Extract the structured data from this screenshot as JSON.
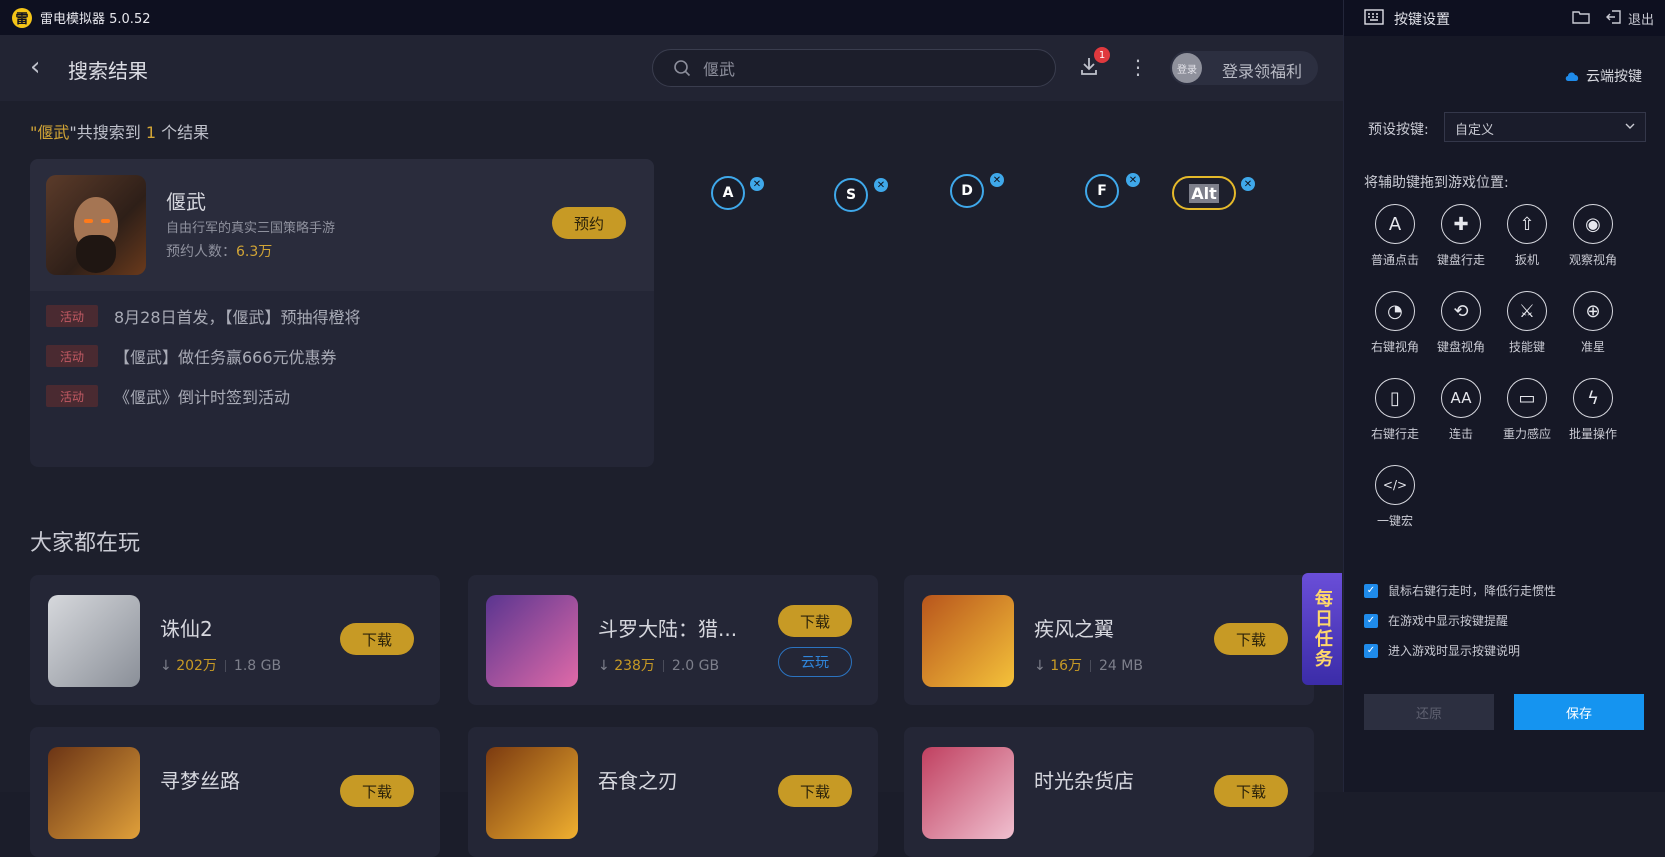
{
  "app": {
    "logo_letter": "雷",
    "title": "雷电模拟器 5.0.52"
  },
  "header": {
    "page_title": "搜索结果",
    "search_value": "偃武",
    "download_badge": "1",
    "avatar_text": "登录",
    "login_label": "登录领福利"
  },
  "result": {
    "prefix": "\"",
    "keyword": "偃武",
    "mid": "\"共搜索到 ",
    "count": "1",
    "suffix": " 个结果"
  },
  "game": {
    "name": "偃武",
    "desc": "自由行军的真实三国策略手游",
    "count_label": "预约人数：",
    "count_value": "6.3万",
    "reserve_label": "预约",
    "activities": [
      {
        "badge": "活动",
        "text": "8月28日首发，【偃武】预抽得橙将"
      },
      {
        "badge": "活动",
        "text": "【偃武】做任务赢666元优惠券"
      },
      {
        "badge": "活动",
        "text": "《偃武》倒计时签到活动"
      }
    ]
  },
  "keys": [
    "A",
    "S",
    "D",
    "F",
    "Alt"
  ],
  "section_title": "大家都在玩",
  "recommend": [
    {
      "name": "诛仙2",
      "count": "202万",
      "size": "1.8 GB",
      "btn": "下载",
      "colors": [
        "#cfd2d6",
        "#8a8f98"
      ]
    },
    {
      "name": "斗罗大陆：猎...",
      "count": "238万",
      "size": "2.0 GB",
      "btn": "下载",
      "cloud": "云玩",
      "colors": [
        "#6d3fa0",
        "#e06aa8"
      ]
    },
    {
      "name": "疾风之翼",
      "count": "16万",
      "size": "24 MB",
      "btn": "下载",
      "colors": [
        "#b8551c",
        "#f4c23a"
      ]
    },
    {
      "name": "寻梦丝路",
      "count": "",
      "size": "",
      "btn": "下载",
      "colors": [
        "#6b3415",
        "#e0a03a"
      ]
    },
    {
      "name": "吞食之刃",
      "count": "",
      "size": "",
      "btn": "下载",
      "colors": [
        "#7b3a10",
        "#f0b030"
      ]
    },
    {
      "name": "时光杂货店",
      "count": "",
      "size": "",
      "btn": "下载",
      "colors": [
        "#c04060",
        "#f0c0d0"
      ]
    }
  ],
  "daily_task": "每日任务",
  "panel": {
    "title": "按键设置",
    "exit_label": "退出",
    "cloud_key": "云端按键",
    "preset_label": "预设按键:",
    "preset_value": "自定义",
    "drag_label": "将辅助键拖到游戏位置:",
    "tools": [
      {
        "label": "普通点击",
        "glyph": "A"
      },
      {
        "label": "键盘行走",
        "glyph": "✚"
      },
      {
        "label": "扳机",
        "glyph": "⇧"
      },
      {
        "label": "观察视角",
        "glyph": "◉"
      },
      {
        "label": "右键视角",
        "glyph": "◔"
      },
      {
        "label": "键盘视角",
        "glyph": "⟲"
      },
      {
        "label": "技能键",
        "glyph": "⚔"
      },
      {
        "label": "准星",
        "glyph": "⊕"
      },
      {
        "label": "右键行走",
        "glyph": "▯"
      },
      {
        "label": "连击",
        "glyph": "AA"
      },
      {
        "label": "重力感应",
        "glyph": "▭"
      },
      {
        "label": "批量操作",
        "glyph": "ϟ"
      },
      {
        "label": "一键宏",
        "glyph": "</>"
      }
    ],
    "checks": [
      "鼠标右键行走时，降低行走惯性",
      "在游戏中显示按键提醒",
      "进入游戏时显示按键说明"
    ],
    "restore_label": "还原",
    "save_label": "保存"
  }
}
